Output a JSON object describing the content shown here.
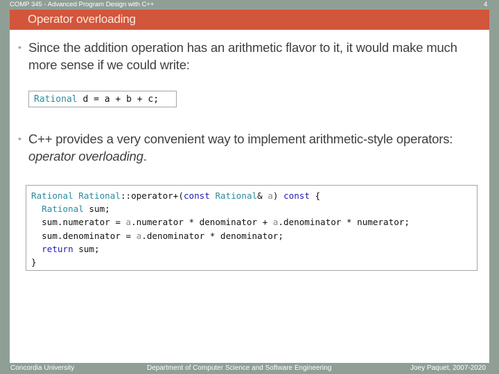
{
  "header": {
    "course": "COMP 345 - Advanced Program Design with C++",
    "page_number": "4"
  },
  "slide": {
    "title": "Operator overloading",
    "bullets": [
      {
        "text": "Since the addition operation has an arithmetic flavor to it, it would make much more sense if we could write:"
      },
      {
        "text_before": "C++ provides a very convenient way to implement arithmetic-style operators: ",
        "text_italic": "operator overloading",
        "text_after": "."
      }
    ],
    "code1": {
      "type": "Rational",
      "rest": " d = a + b + c;"
    },
    "code2": {
      "l1_type1": "Rational",
      "l1_sp": " ",
      "l1_type2": "Rational",
      "l1_op": "::operator+(",
      "l1_kw1": "const",
      "l1_sp2": " ",
      "l1_type3": "Rational",
      "l1_amp": "& ",
      "l1_param": "a",
      "l1_close": ") ",
      "l1_kw2": "const",
      "l1_brace": " {",
      "l2_indent": "  ",
      "l2_type": "Rational",
      "l2_rest": " sum;",
      "l3_a": "  sum.numerator = ",
      "l3_param": "a",
      "l3_b": ".numerator * denominator + ",
      "l3_param2": "a",
      "l3_c": ".denominator * numerator;",
      "l4_a": "  sum.denominator = ",
      "l4_param": "a",
      "l4_b": ".denominator * denominator;",
      "l5_indent": "  ",
      "l5_kw": "return",
      "l5_rest": " sum;",
      "l6": "}"
    },
    "bullet_icon": "bullet-dot"
  },
  "footer": {
    "left": "Concordia University",
    "center": "Department of Computer Science and Software Engineering",
    "right": "Joey Paquet, 2007-2020"
  },
  "colors": {
    "title_bar": "#d2563b",
    "frame": "#8f9f96",
    "type_color": "#2b8a9e",
    "keyword_color": "#1c1cb4",
    "param_color": "#8a8a8a"
  }
}
